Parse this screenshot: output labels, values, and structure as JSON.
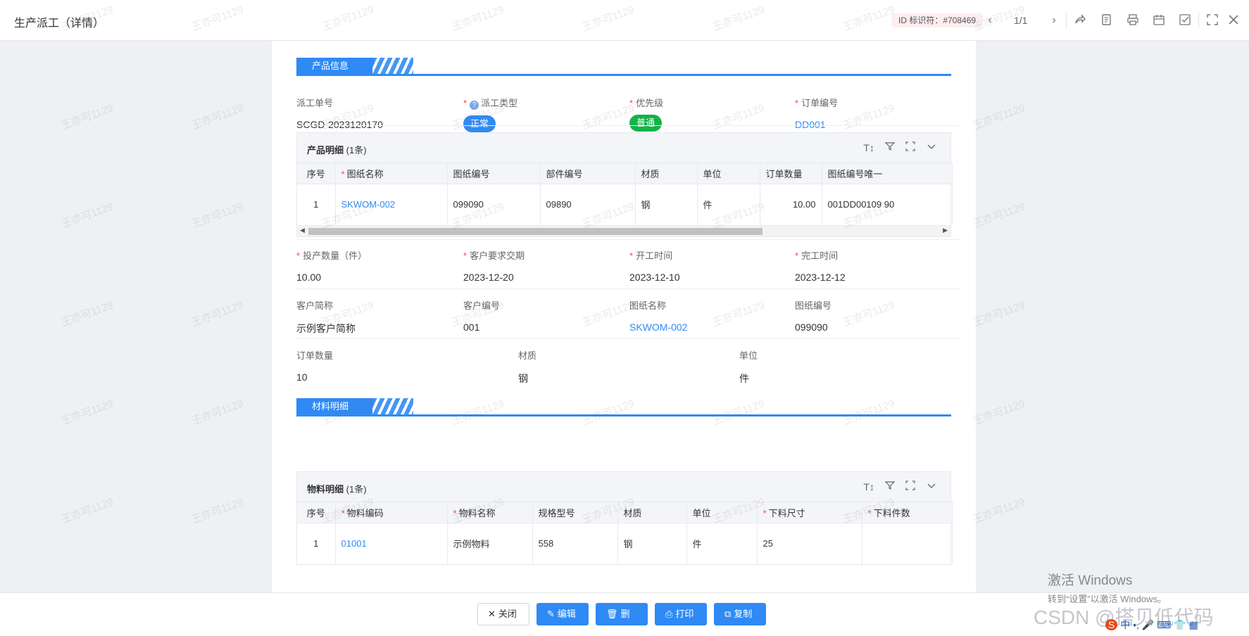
{
  "header": {
    "title": "生产派工（详情）",
    "id_badge": "ID 标识符：#708469",
    "pager": "1/1",
    "icons": [
      "chevron-left-icon",
      "chevron-right-icon",
      "share-icon",
      "doc-icon",
      "print-icon",
      "calendar-icon",
      "check-icon",
      "fullscreen-icon",
      "close-icon"
    ]
  },
  "product_section": {
    "tag": "产品信息",
    "fields_row1": [
      {
        "label": "派工单号",
        "value": "SCGD-2023120170",
        "required": false
      },
      {
        "label": "派工类型",
        "value": "正常",
        "required": true,
        "help": true,
        "pill": "blue"
      },
      {
        "label": "优先级",
        "value": "普通",
        "required": true,
        "pill": "green"
      },
      {
        "label": "订单编号",
        "value": "DD001",
        "required": true,
        "link": true
      }
    ],
    "product_detail": {
      "title": "产品明细",
      "count": "(1条)",
      "columns": [
        "序号",
        "图纸名称",
        "图纸编号",
        "部件编号",
        "材质",
        "单位",
        "订单数量",
        "图纸编号唯一"
      ],
      "rows": [
        {
          "seq": "1",
          "drawing_name": "SKWOM-002",
          "drawing_no": "099090",
          "part_no": "09890",
          "material": "钢",
          "unit": "件",
          "qty": "10.00",
          "unique": "001DD00109 90"
        }
      ]
    },
    "fields_row2": [
      {
        "label": "投产数量（件）",
        "value": "10.00"
      },
      {
        "label": "客户要求交期",
        "value": "2023-12-20"
      },
      {
        "label": "开工时间",
        "value": "2023-12-10"
      },
      {
        "label": "完工时间",
        "value": "2023-12-12"
      }
    ],
    "fields_row3": [
      {
        "label": "客户简称",
        "value": "示例客户简称"
      },
      {
        "label": "客户编号",
        "value": "001"
      },
      {
        "label": "图纸名称",
        "value": "SKWOM-002"
      },
      {
        "label": "图纸编号",
        "value": "099090"
      }
    ],
    "fields_row4": [
      {
        "label": "订单数量",
        "value": "10"
      },
      {
        "label": "材质",
        "value": "钢"
      },
      {
        "label": "单位",
        "value": "件"
      }
    ]
  },
  "material_section": {
    "tag": "材料明细",
    "material_detail": {
      "title": "物料明细",
      "count": "(1条)",
      "columns": [
        "序号",
        "物料编码",
        "物料名称",
        "规格型号",
        "材质",
        "单位",
        "下料尺寸",
        "下料件数"
      ],
      "rows": [
        {
          "seq": "1",
          "code": "01001",
          "name": "示例物料",
          "spec": "558",
          "material": "钢",
          "unit": "件",
          "size": "25",
          "count": ""
        }
      ]
    }
  },
  "footer": {
    "close": "关闭",
    "edit": "编辑",
    "delete": "删除",
    "print": "打印",
    "copy": "复制"
  },
  "watermark": "王亦可1129",
  "windows_activation": {
    "line1": "激活 Windows",
    "line2": "转到“设置”以激活 Windows。"
  },
  "csdn_mark": "CSDN @搭贝低代码",
  "tray_ime": "中"
}
